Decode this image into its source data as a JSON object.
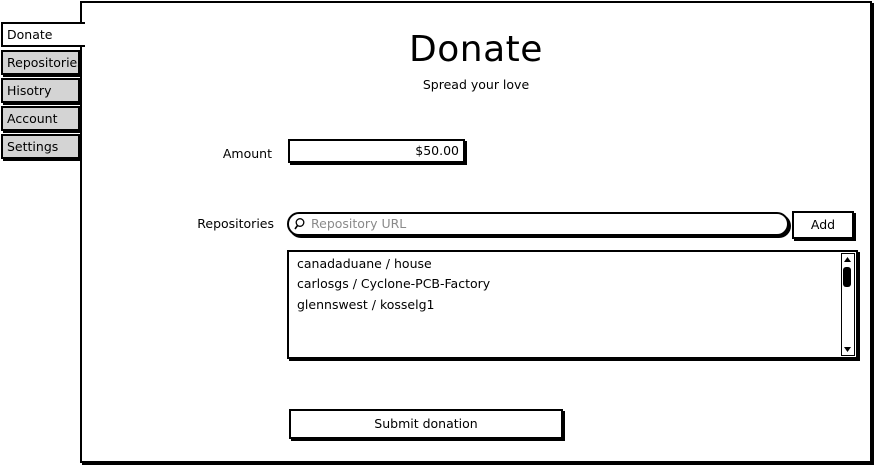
{
  "tabs": [
    {
      "label": "Donate"
    },
    {
      "label": "Repositories"
    },
    {
      "label": "Hisotry"
    },
    {
      "label": "Account"
    },
    {
      "label": "Settings"
    }
  ],
  "page": {
    "title": "Donate",
    "subtitle": "Spread your love"
  },
  "form": {
    "amount_label": "Amount",
    "amount_value": "$50.00",
    "repositories_label": "Repositories",
    "search_placeholder": "Repository URL",
    "add_label": "Add",
    "repositories": [
      {
        "name": "canadaduane / house"
      },
      {
        "name": "carlosgs / Cyclone-PCB-Factory"
      },
      {
        "name": "glennswest / kosselg1"
      }
    ],
    "submit_label": "Submit donation"
  }
}
